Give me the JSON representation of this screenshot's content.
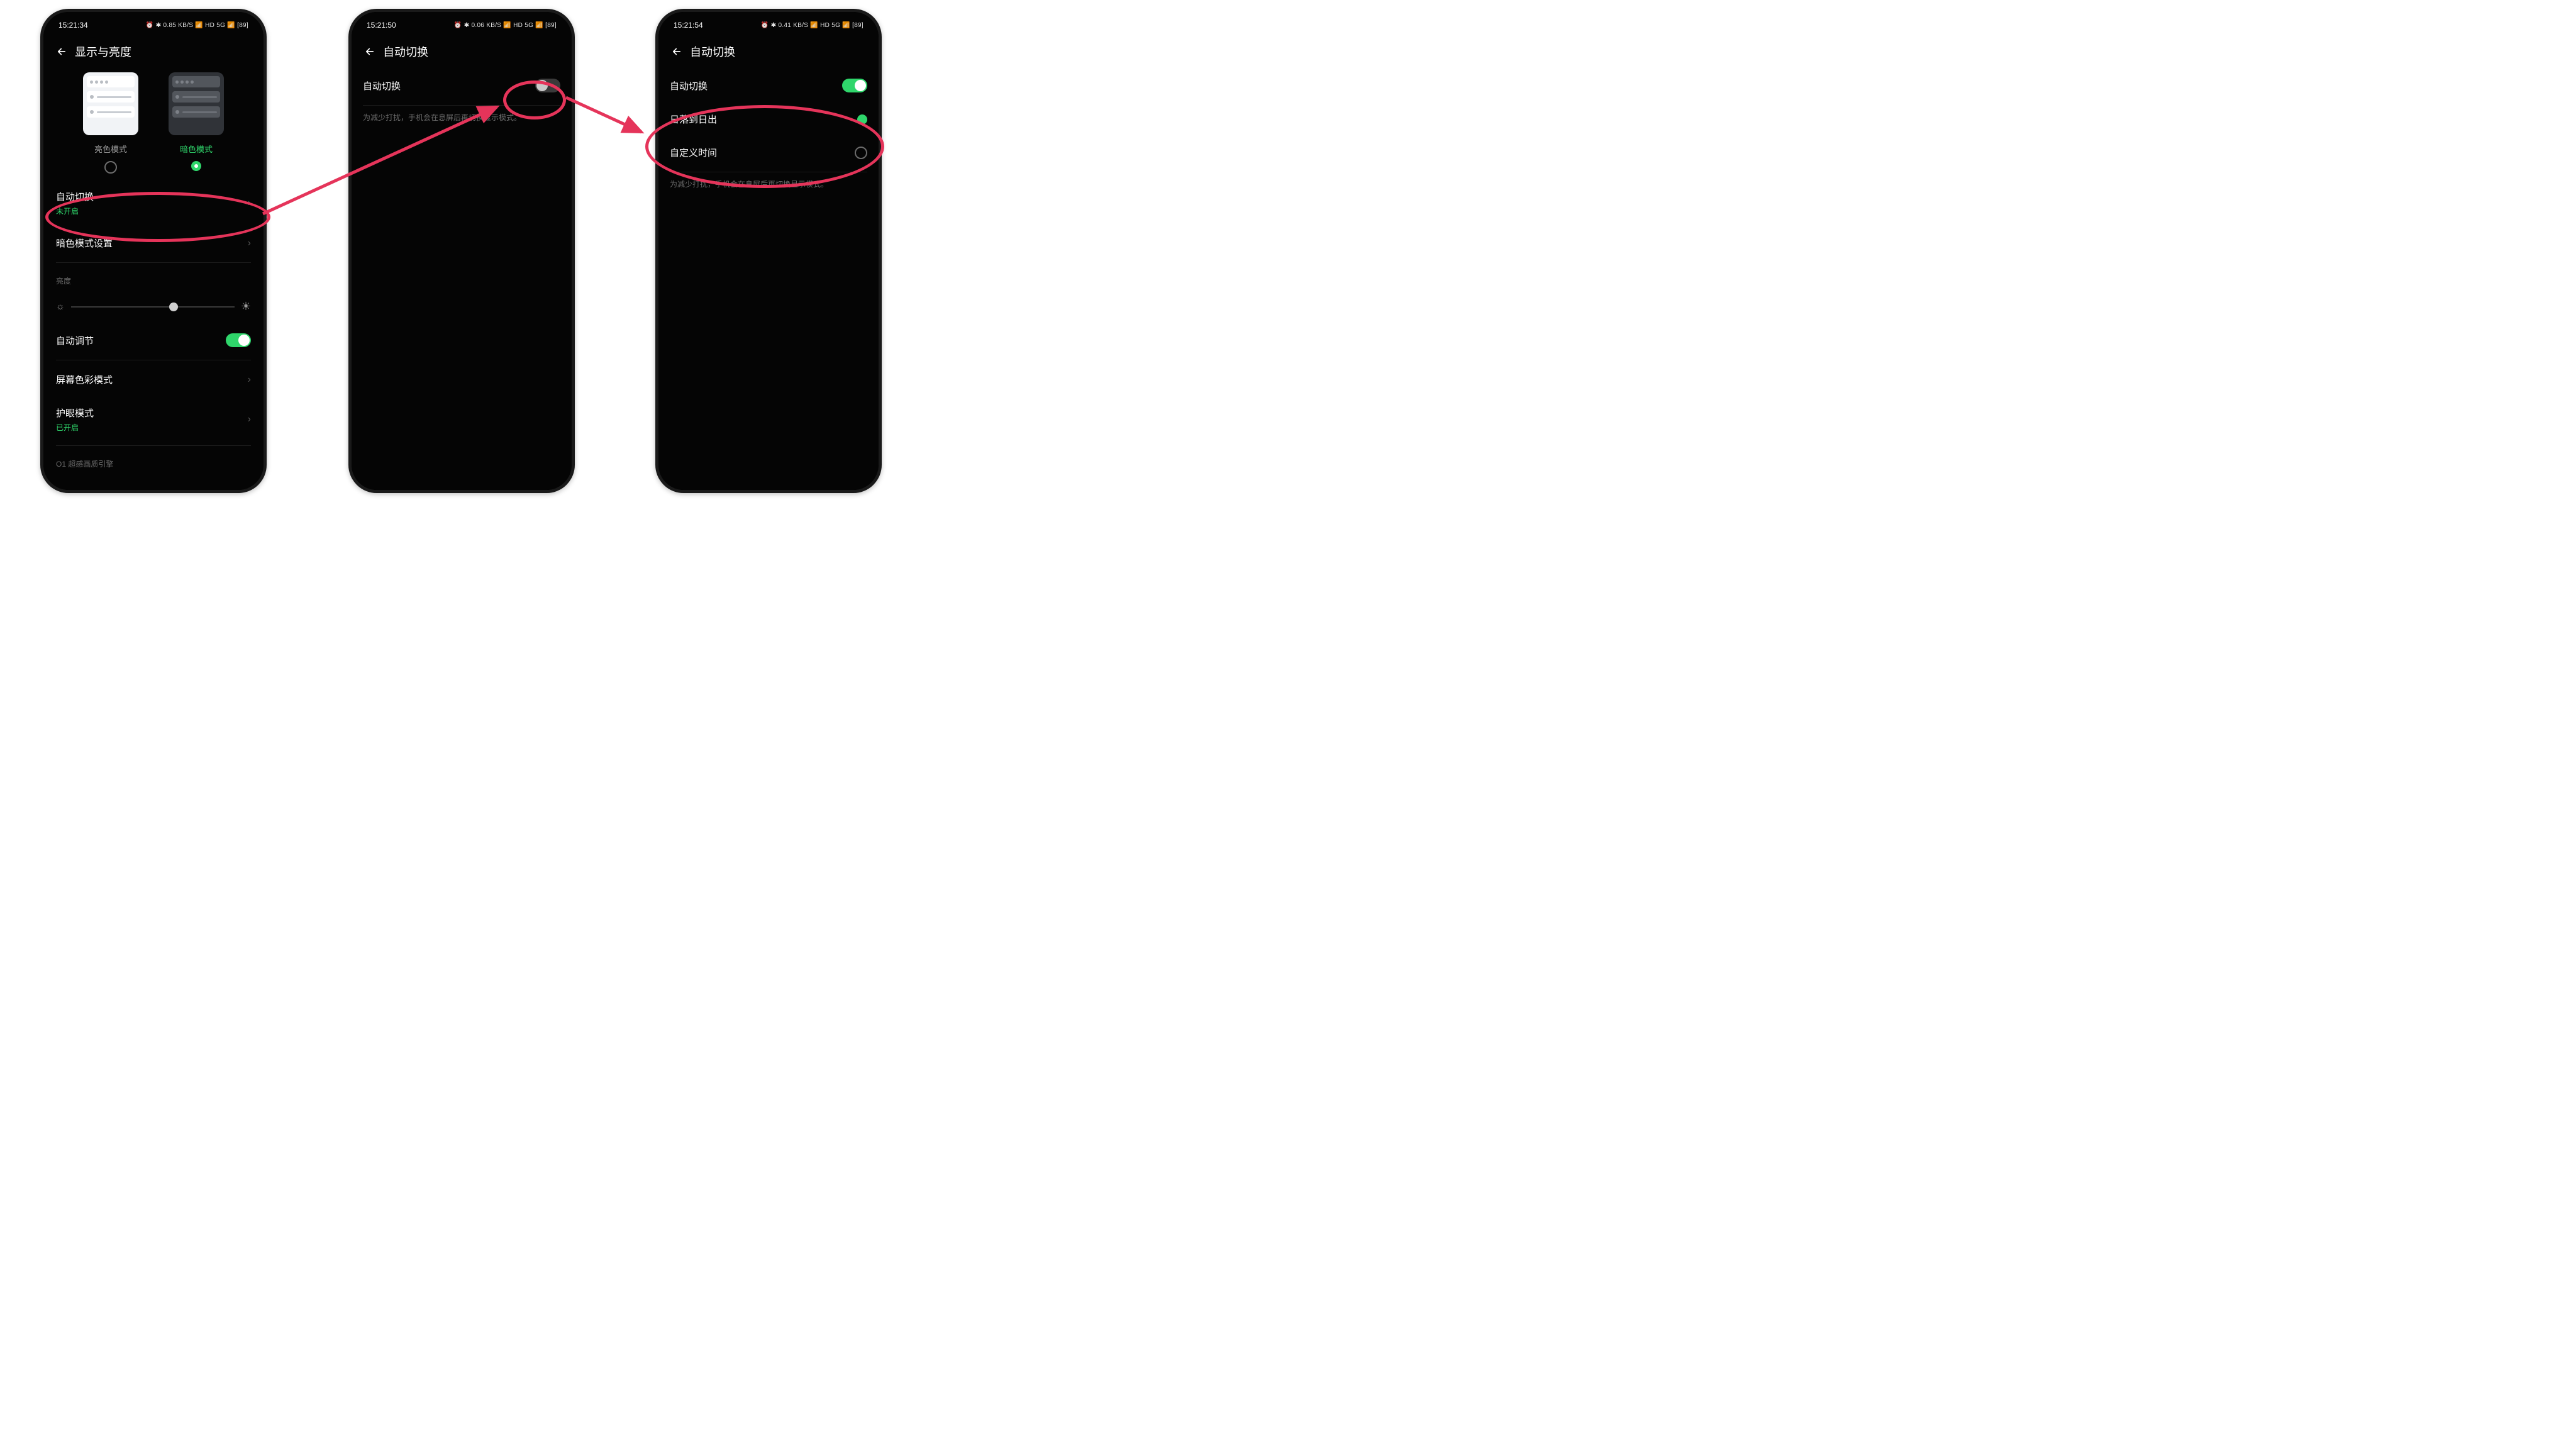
{
  "colors": {
    "accent": "#2fd66b",
    "annotation": "#e5345a"
  },
  "phones": [
    {
      "status": {
        "time": "15:21:34",
        "right": "⏰ ✱ 0.85 KB/S 📶 HD 5G 📶 [89]"
      },
      "title": "显示与亮度",
      "lightLabel": "亮色模式",
      "darkLabel": "暗色模式",
      "rows": {
        "ziDongQieHuan": {
          "label": "自动切换",
          "sub": "未开启"
        },
        "anSeSheZhi": {
          "label": "暗色模式设置"
        },
        "liangDu": {
          "label": "亮度"
        },
        "ziDongTiaoJie": {
          "label": "自动调节"
        },
        "seCai": {
          "label": "屏幕色彩模式"
        },
        "huYan": {
          "label": "护眼模式",
          "sub": "已开启"
        },
        "o1": {
          "label": "O1 超感画质引擎"
        }
      }
    },
    {
      "status": {
        "time": "15:21:50",
        "right": "⏰ ✱ 0.06 KB/S 📶 HD 5G 📶 [89]"
      },
      "title": "自动切换",
      "rows": {
        "ziDongQieHuan": {
          "label": "自动切换"
        }
      },
      "hint": "为减少打扰，手机会在息屏后再切换显示模式。"
    },
    {
      "status": {
        "time": "15:21:54",
        "right": "⏰ ✱ 0.41 KB/S 📶 HD 5G 📶 [89]"
      },
      "title": "自动切换",
      "rows": {
        "ziDongQieHuan": {
          "label": "自动切换"
        },
        "riLuo": {
          "label": "日落到日出"
        },
        "ziDingYi": {
          "label": "自定义时间"
        }
      },
      "hint": "为减少打扰，手机会在息屏后再切换显示模式。"
    }
  ]
}
